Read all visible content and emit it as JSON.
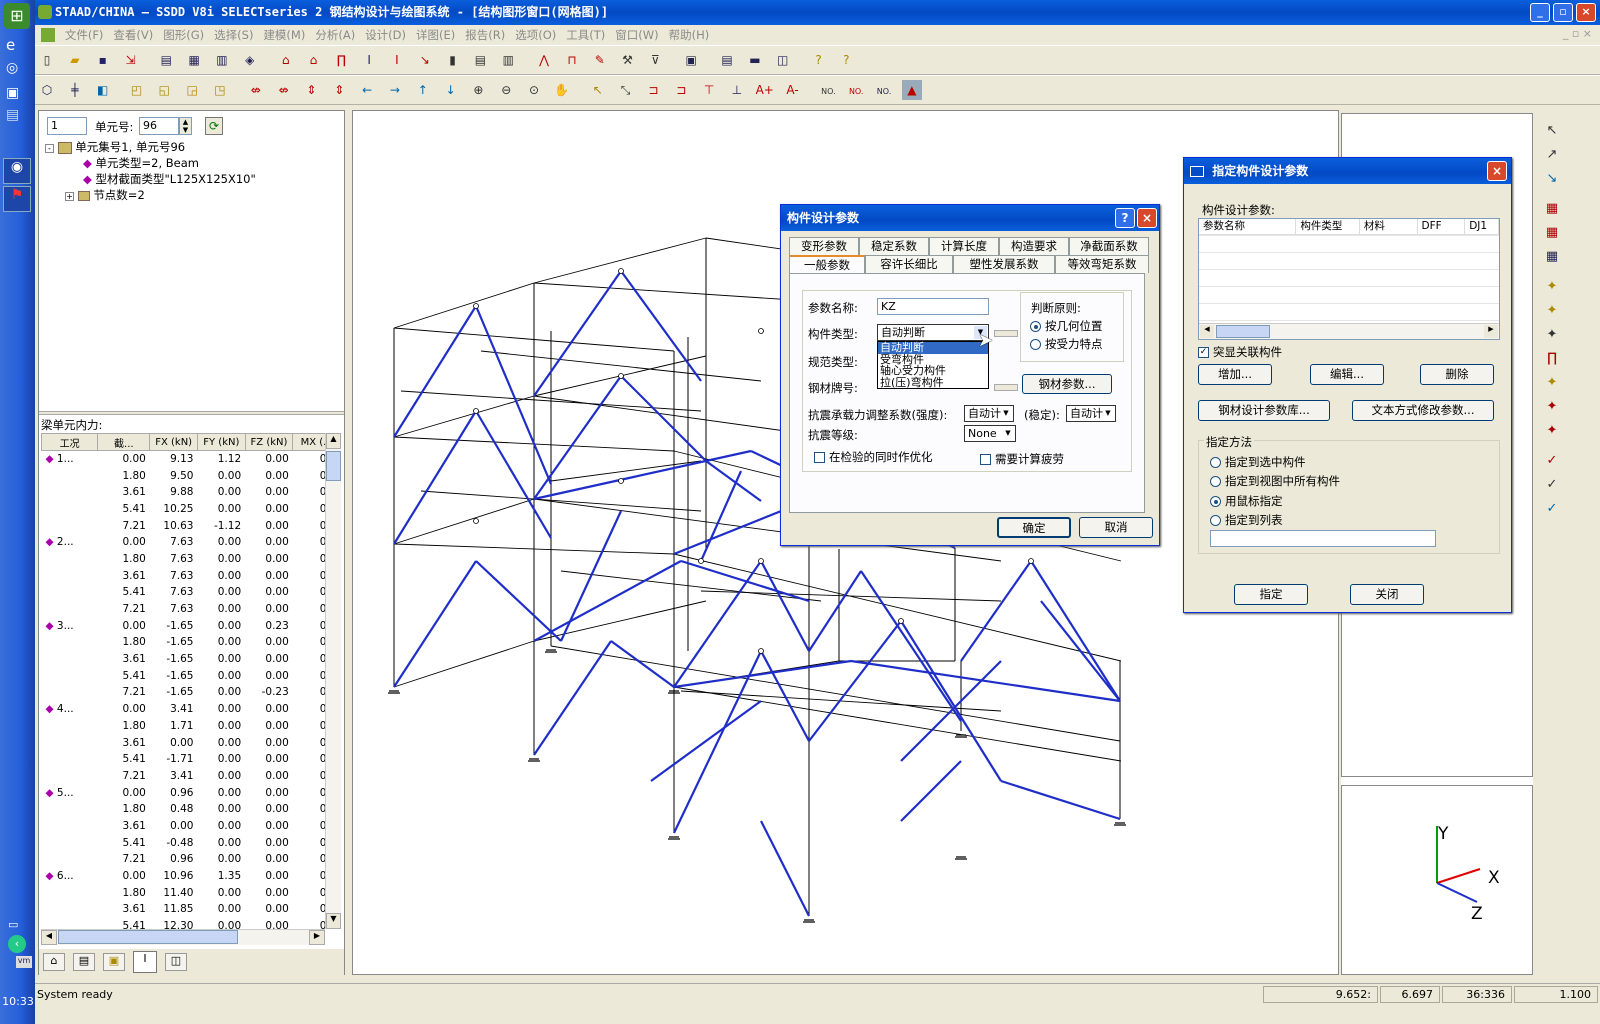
{
  "window": {
    "title": "STAAD/CHINA — SSDD V8i SELECTseries 2 钢结构设计与绘图系统 - [结构图形窗口(网格图)]",
    "minimize": "_",
    "restore": "▫",
    "close": "×"
  },
  "taskbar": {
    "clock": "10:33"
  },
  "menu": [
    "文件(F)",
    "查看(V)",
    "图形(G)",
    "选择(S)",
    "建模(M)",
    "分析(A)",
    "设计(D)",
    "详图(E)",
    "报告(R)",
    "选项(O)",
    "工具(T)",
    "窗口(W)",
    "帮助(H)"
  ],
  "left_panel": {
    "group_value": "1",
    "element_label": "单元号:",
    "element_value": "96",
    "tree": {
      "root": "单元集号1, 单元号96",
      "child1": "单元类型=2, Beam",
      "child2": "型材截面类型\"L125X125X10\"",
      "child3": "节点数=2"
    },
    "forces_title": "梁单元内力:",
    "columns": [
      "工况",
      "截...",
      "FX (kN)",
      "FY (kN)",
      "FZ (kN)",
      "MX (..."
    ],
    "rows": [
      [
        "1...",
        "0.00",
        "9.13",
        "1.12",
        "0.00",
        "0.0"
      ],
      [
        "",
        "1.80",
        "9.50",
        "0.00",
        "0.00",
        "0.0"
      ],
      [
        "",
        "3.61",
        "9.88",
        "0.00",
        "0.00",
        "0.0"
      ],
      [
        "",
        "5.41",
        "10.25",
        "0.00",
        "0.00",
        "0.0"
      ],
      [
        "",
        "7.21",
        "10.63",
        "-1.12",
        "0.00",
        "0.0"
      ],
      [
        "2...",
        "0.00",
        "7.63",
        "0.00",
        "0.00",
        "0.0"
      ],
      [
        "",
        "1.80",
        "7.63",
        "0.00",
        "0.00",
        "0.0"
      ],
      [
        "",
        "3.61",
        "7.63",
        "0.00",
        "0.00",
        "0.0"
      ],
      [
        "",
        "5.41",
        "7.63",
        "0.00",
        "0.00",
        "0.0"
      ],
      [
        "",
        "7.21",
        "7.63",
        "0.00",
        "0.00",
        "0.0"
      ],
      [
        "3...",
        "0.00",
        "-1.65",
        "0.00",
        "0.23",
        "0.0"
      ],
      [
        "",
        "1.80",
        "-1.65",
        "0.00",
        "0.00",
        "0.0"
      ],
      [
        "",
        "3.61",
        "-1.65",
        "0.00",
        "0.00",
        "0.0"
      ],
      [
        "",
        "5.41",
        "-1.65",
        "0.00",
        "0.00",
        "0.0"
      ],
      [
        "",
        "7.21",
        "-1.65",
        "0.00",
        "-0.23",
        "0.0"
      ],
      [
        "4...",
        "0.00",
        "3.41",
        "0.00",
        "0.00",
        "0.0"
      ],
      [
        "",
        "1.80",
        "1.71",
        "0.00",
        "0.00",
        "0.0"
      ],
      [
        "",
        "3.61",
        "0.00",
        "0.00",
        "0.00",
        "0.0"
      ],
      [
        "",
        "5.41",
        "-1.71",
        "0.00",
        "0.00",
        "0.0"
      ],
      [
        "",
        "7.21",
        "3.41",
        "0.00",
        "0.00",
        "0.0"
      ],
      [
        "5...",
        "0.00",
        "0.96",
        "0.00",
        "0.00",
        "0.0"
      ],
      [
        "",
        "1.80",
        "0.48",
        "0.00",
        "0.00",
        "0.0"
      ],
      [
        "",
        "3.61",
        "0.00",
        "0.00",
        "0.00",
        "0.0"
      ],
      [
        "",
        "5.41",
        "-0.48",
        "0.00",
        "0.00",
        "0.0"
      ],
      [
        "",
        "7.21",
        "0.96",
        "0.00",
        "0.00",
        "0.0"
      ],
      [
        "6...",
        "0.00",
        "10.96",
        "1.35",
        "0.00",
        "0.0"
      ],
      [
        "",
        "1.80",
        "11.40",
        "0.00",
        "0.00",
        "0.0"
      ],
      [
        "",
        "3.61",
        "11.85",
        "0.00",
        "0.00",
        "0.0"
      ],
      [
        "",
        "5.41",
        "12.30",
        "0.00",
        "0.00",
        "0.0"
      ]
    ]
  },
  "member_dialog": {
    "title": "构件设计参数",
    "help": "?",
    "close": "×",
    "tabs_row1": [
      "变形参数",
      "稳定系数",
      "计算长度",
      "构造要求",
      "净截面系数"
    ],
    "tabs_row2": [
      "一般参数",
      "容许长细比",
      "塑性发展系数",
      "等效弯矩系数"
    ],
    "param_name_label": "参数名称:",
    "param_name_value": "KZ",
    "member_type_label": "构件类型:",
    "member_type_value": "自动判断",
    "code_type_label": "规范类型:",
    "steel_grade_label": "钢材牌号:",
    "dropdown_options": [
      "自动判断",
      "受弯构件",
      "轴心受力构件",
      "拉(压)弯构件"
    ],
    "judge_title": "判断原则:",
    "judge_opt1": "按几何位置",
    "judge_opt2": "按受力特点",
    "steel_params_button": "钢材参数...",
    "seismic_adjust_label": "抗震承载力调整系数(强度):",
    "seismic_adjust_value": "自动计",
    "stability_label": "(稳定):",
    "stability_value": "自动计",
    "seismic_grade_label": "抗震等级:",
    "seismic_grade_value": "None",
    "optimize_label": "在检验的同时作优化",
    "fatigue_label": "需要计算疲劳",
    "ok": "确定",
    "cancel": "取消"
  },
  "assign_dialog": {
    "title": "指定构件设计参数",
    "close": "×",
    "params_label": "构件设计参数:",
    "columns": [
      "参数名称",
      "构件类型",
      "材料",
      "DFF",
      "DJ1"
    ],
    "highlight_label": "突显关联构件",
    "add": "增加...",
    "edit": "编辑...",
    "delete": "删除",
    "library": "钢材设计参数库...",
    "text_edit": "文本方式修改参数...",
    "method_title": "指定方法",
    "method1": "指定到选中构件",
    "method2": "指定到视图中所有构件",
    "method3": "用鼠标指定",
    "method4": "指定到列表",
    "assign": "指定",
    "close_btn": "关闭"
  },
  "axes": {
    "y": "Y",
    "x": "X",
    "z": "Z"
  },
  "status": {
    "text": "System ready",
    "x": "9.652:",
    "y": "6.697",
    "ratio": "36:336",
    "zoom": "1.100"
  },
  "colors": {
    "brace": "#1f2ec8",
    "titlebar": "#0a5fdc",
    "axis_y": "#00a000",
    "axis_x": "#e00000",
    "axis_z": "#1f2ec8"
  }
}
